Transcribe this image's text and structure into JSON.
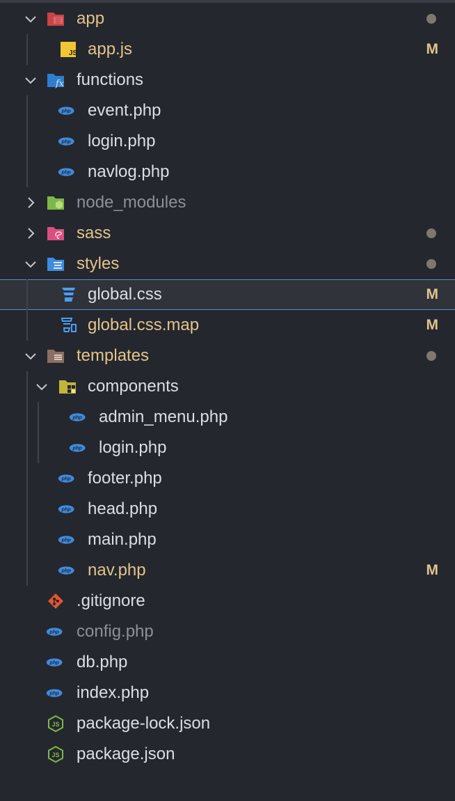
{
  "explorer": {
    "rows": [
      {
        "label": "app",
        "kind": "folder",
        "expanded": true,
        "icon": "app-folder-icon",
        "color": "mod",
        "status": "dot"
      },
      {
        "label": "app.js",
        "kind": "file",
        "icon": "js-file-icon",
        "color": "mod",
        "status": "M"
      },
      {
        "label": "functions",
        "kind": "folder",
        "expanded": true,
        "icon": "functions-folder-icon",
        "color": "def"
      },
      {
        "label": "event.php",
        "kind": "file",
        "icon": "php-file-icon",
        "color": "def"
      },
      {
        "label": "login.php",
        "kind": "file",
        "icon": "php-file-icon",
        "color": "def"
      },
      {
        "label": "navlog.php",
        "kind": "file",
        "icon": "php-file-icon",
        "color": "def"
      },
      {
        "label": "node_modules",
        "kind": "folder",
        "expanded": false,
        "icon": "node-folder-icon",
        "color": "dim"
      },
      {
        "label": "sass",
        "kind": "folder",
        "expanded": false,
        "icon": "sass-folder-icon",
        "color": "mod",
        "status": "dot"
      },
      {
        "label": "styles",
        "kind": "folder",
        "expanded": true,
        "icon": "styles-folder-icon",
        "color": "mod",
        "status": "dot"
      },
      {
        "label": "global.css",
        "kind": "file",
        "icon": "css-file-icon",
        "color": "def",
        "status": "M",
        "selected": true
      },
      {
        "label": "global.css.map",
        "kind": "file",
        "icon": "css-map-file-icon",
        "color": "mod",
        "status": "M"
      },
      {
        "label": "templates",
        "kind": "folder",
        "expanded": true,
        "icon": "templates-folder-icon",
        "color": "mod",
        "status": "dot"
      },
      {
        "label": "components",
        "kind": "folder",
        "expanded": true,
        "icon": "components-folder-icon",
        "color": "def"
      },
      {
        "label": "admin_menu.php",
        "kind": "file",
        "icon": "php-file-icon",
        "color": "def"
      },
      {
        "label": "login.php",
        "kind": "file",
        "icon": "php-file-icon",
        "color": "def"
      },
      {
        "label": "footer.php",
        "kind": "file",
        "icon": "php-file-icon",
        "color": "def"
      },
      {
        "label": "head.php",
        "kind": "file",
        "icon": "php-file-icon",
        "color": "def"
      },
      {
        "label": "main.php",
        "kind": "file",
        "icon": "php-file-icon",
        "color": "def"
      },
      {
        "label": "nav.php",
        "kind": "file",
        "icon": "php-file-icon",
        "color": "mod",
        "status": "M"
      },
      {
        "label": ".gitignore",
        "kind": "file",
        "icon": "git-file-icon",
        "color": "def"
      },
      {
        "label": "config.php",
        "kind": "file",
        "icon": "php-file-icon",
        "color": "dim"
      },
      {
        "label": "db.php",
        "kind": "file",
        "icon": "php-file-icon",
        "color": "def"
      },
      {
        "label": "index.php",
        "kind": "file",
        "icon": "php-file-icon",
        "color": "def"
      },
      {
        "label": "package-lock.json",
        "kind": "file",
        "icon": "nodejs-file-icon",
        "color": "def"
      },
      {
        "label": "package.json",
        "kind": "file",
        "icon": "nodejs-file-icon",
        "color": "def"
      }
    ]
  },
  "colors": {
    "background": "#24272e",
    "modified_text": "#e3c48b",
    "default_text": "#dcdee3",
    "ignored_text": "#8c9099",
    "selection_border": "#5b8bd8"
  }
}
